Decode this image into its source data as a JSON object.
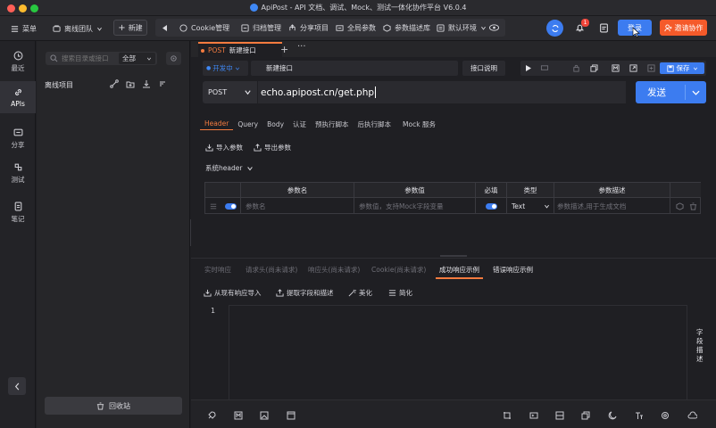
{
  "window": {
    "title": "ApiPost - API 文档、调试、Mock、测试一体化协作平台 V6.0.4"
  },
  "toolbar": {
    "menu_label": "菜单",
    "team_label": "离线团队",
    "new_label": "新建",
    "cookie_label": "Cookie管理",
    "archive_label": "归档管理",
    "share_label": "分享项目",
    "global_params_label": "全局参数",
    "param_desc_label": "参数描述库",
    "env_label": "默认环境",
    "notification_count": "1",
    "login_label": "登录",
    "invite_label": "邀请协作"
  },
  "rail": {
    "items": [
      {
        "label": "最近",
        "icon": "clock-icon"
      },
      {
        "label": "APIs",
        "icon": "link-icon"
      },
      {
        "label": "分享",
        "icon": "share-icon"
      },
      {
        "label": "测试",
        "icon": "test-icon"
      },
      {
        "label": "笔记",
        "icon": "note-icon"
      }
    ]
  },
  "project_panel": {
    "search_placeholder": "搜索目录或接口",
    "filter_value": "全部",
    "project_name": "离线项目",
    "recycle_label": "回收站"
  },
  "tabs": [
    {
      "method": "POST",
      "name": "新建接口"
    }
  ],
  "request": {
    "env": "开发中",
    "name": "新建接口",
    "doc_button": "接口说明",
    "save_label": "保存",
    "method": "POST",
    "url": "echo.apipost.cn/get.php",
    "send_label": "发送"
  },
  "sub_tabs": [
    "Header",
    "Query",
    "Body",
    "认证",
    "预执行脚本",
    "后执行脚本",
    "Mock 服务"
  ],
  "actions": {
    "import_params": "导入参数",
    "export_params": "导出参数",
    "system_header": "系统header"
  },
  "params_table": {
    "headers": [
      "参数名",
      "参数值",
      "必填",
      "类型",
      "参数描述"
    ],
    "row": {
      "name_placeholder": "参数名",
      "value_placeholder": "参数值，支持Mock字段变量",
      "type": "Text",
      "desc_placeholder": "参数描述,用于生成文档"
    }
  },
  "response_tabs": [
    "实时响应",
    "请求头(尚未请求)",
    "响应头(尚未请求)",
    "Cookie(尚未请求)",
    "成功响应示例",
    "错误响应示例"
  ],
  "response_actions": {
    "import_from_response": "从现有响应导入",
    "extract_fields": "提取字段和描述",
    "beautify": "美化",
    "simplify": "简化"
  },
  "editor": {
    "line_number": "1"
  },
  "side_label": "字段描述",
  "colors": {
    "accent": "#3c7cf0",
    "orange": "#f37b3f",
    "invite": "#f55a2a"
  }
}
